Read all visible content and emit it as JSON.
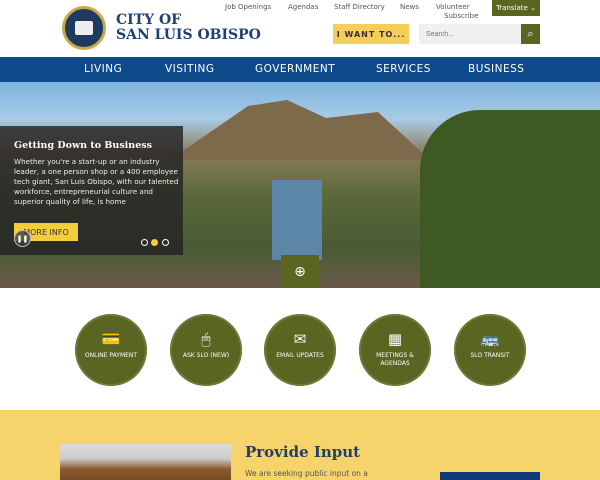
{
  "utility_links": [
    "Job Openings",
    "Agendas",
    "Staff Directory",
    "News",
    "Volunteer",
    "Subscribe"
  ],
  "translate": "Translate ⌄",
  "logo": {
    "line1": "CITY OF",
    "line2": "SAN LUIS OBISPO"
  },
  "i_want_to": "I WANT TO...",
  "search": {
    "placeholder": "Search...",
    "icon": "⌕"
  },
  "nav": [
    "LIVING",
    "VISITING",
    "GOVERNMENT",
    "SERVICES",
    "BUSINESS"
  ],
  "hero": {
    "title": "Getting Down to Business",
    "body": "Whether you're a start-up or an industry leader, a one person shop or a 400 employee tech giant, San Luis Obispo, with our talented workforce, entrepreneurial culture and superior quality of life, is home",
    "button": "MORE INFO",
    "active_slide": 2,
    "slide_count": 3
  },
  "quick_links": [
    {
      "label": "ONLINE PAYMENT",
      "icon": "💳"
    },
    {
      "label": "ASK SLO (NEW)",
      "icon": "🖱"
    },
    {
      "label": "EMAIL UPDATES",
      "icon": "✉"
    },
    {
      "label": "MEETINGS & AGENDAS",
      "icon": "▦"
    },
    {
      "label": "SLO TRANSIT",
      "icon": "🚌"
    }
  ],
  "provide_input": {
    "title": "Provide Input",
    "body": "We are seeking public input on a"
  },
  "colors": {
    "navy": "#0e4a8a",
    "olive": "#5a6522",
    "gold": "#f5cd5b",
    "yellow_bg": "#f7d46b"
  }
}
